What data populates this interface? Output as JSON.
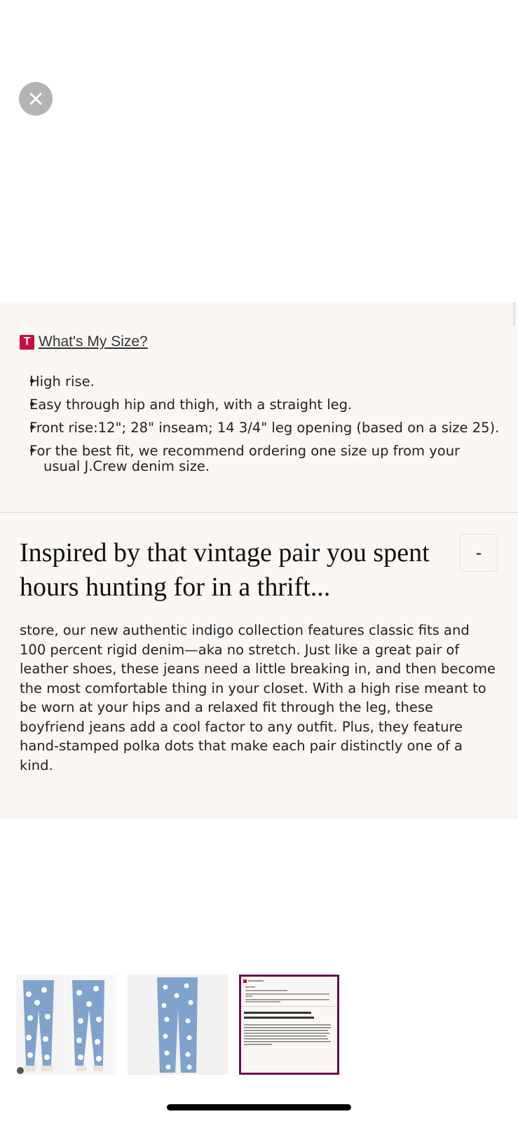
{
  "close_icon": "close-icon",
  "size_guide": {
    "logo_letter": "T",
    "link_label": "What's My Size?"
  },
  "fit_details": [
    "High rise.",
    "Easy through hip and thigh, with a straight leg.",
    "Front rise:12\"; 28\" inseam; 14 3/4\" leg opening (based on a size 25).",
    "For the best fit, we recommend ordering one size up from your usual J.Crew denim size."
  ],
  "description": {
    "heading": "Inspired by that vintage pair you spent hours hunting for in a thrift...",
    "toggle_label": "-",
    "body": "store, our new authentic indigo collection features classic fits and 100 percent rigid denim—aka no stretch. Just like a great pair of leather shoes, these jeans need a little breaking in, and then become the most comfortable thing in your closet. With a high rise meant to be worn at your hips and a relaxed fit through the leg, these boyfriend jeans add a cool factor to any outfit. Plus, they feature hand-stamped polka dots that make each pair distinctly one of a kind."
  },
  "thumbnails": [
    {
      "name": "model-front-back-jeans"
    },
    {
      "name": "flat-lay-jeans"
    },
    {
      "name": "description-screenshot",
      "selected": true
    }
  ],
  "colors": {
    "panel_bg": "#faf7f5",
    "brand_red": "#c8103e",
    "selected_border": "#6b0f4f",
    "denim": "#7fa3cc"
  }
}
